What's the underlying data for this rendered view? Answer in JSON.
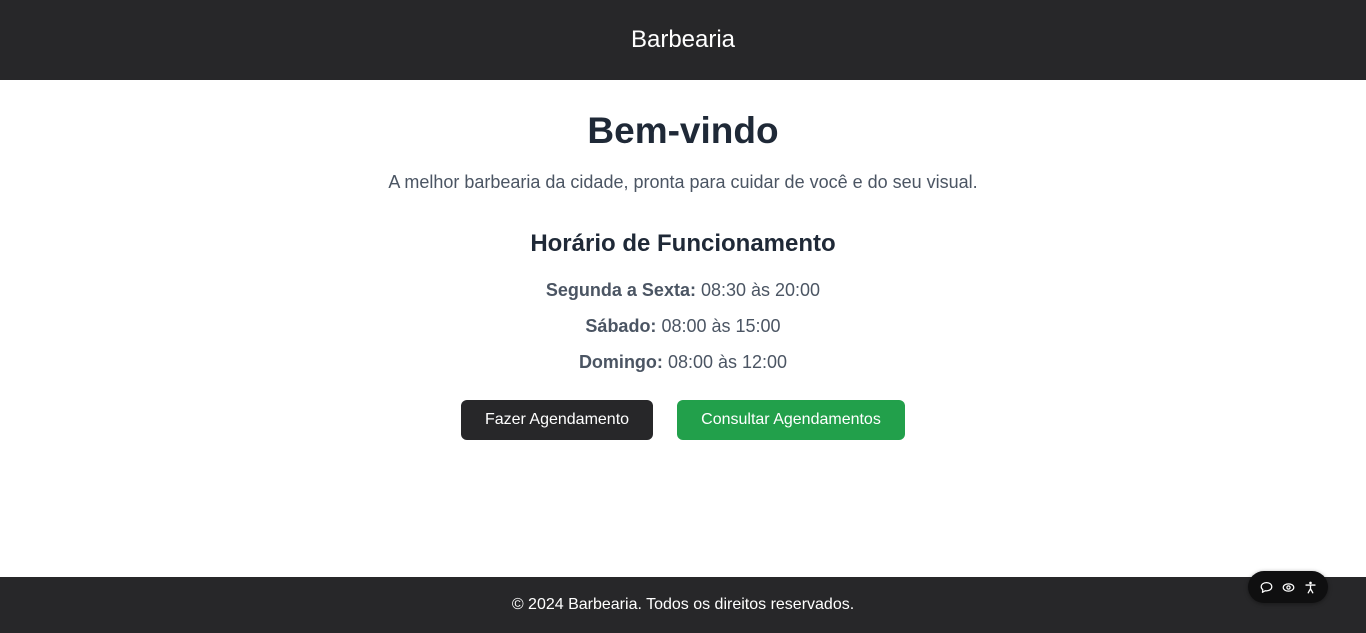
{
  "header": {
    "brand": "Barbearia"
  },
  "hero": {
    "title": "Bem-vindo",
    "subtitle": "A melhor barbearia da cidade, pronta para cuidar de você e do seu visual."
  },
  "hours": {
    "title": "Horário de Funcionamento",
    "rows": [
      {
        "day": "Segunda a Sexta:",
        "time": "08:30 às 20:00"
      },
      {
        "day": "Sábado:",
        "time": "08:00 às 15:00"
      },
      {
        "day": "Domingo:",
        "time": "08:00 às 12:00"
      }
    ]
  },
  "actions": {
    "schedule_label": "Fazer Agendamento",
    "consult_label": "Consultar Agendamentos"
  },
  "footer": {
    "text": "© 2024 Barbearia. Todos os direitos reservados."
  },
  "widget": {
    "icons": [
      "chat-icon",
      "eye-icon",
      "accessibility-icon"
    ]
  },
  "colors": {
    "dark": "#272729",
    "green": "#22a04b",
    "heading": "#1f2937",
    "body_text": "#4b5563"
  }
}
